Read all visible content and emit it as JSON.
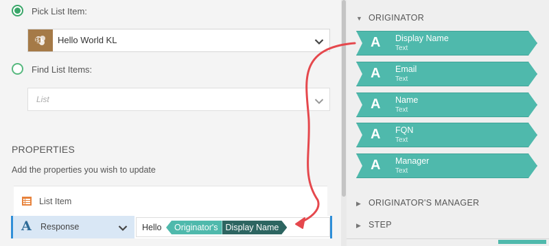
{
  "source": {
    "pick_list_item_label": "Pick List Item:",
    "selected_list": "Hello World KL",
    "find_list_items_label": "Find List Items:",
    "list_placeholder": "List"
  },
  "properties": {
    "title": "PROPERTIES",
    "description": "Add the properties you wish to update",
    "list_item_label": "List Item",
    "response_label": "Response",
    "response_value": {
      "text": "Hello",
      "token_prefix": "Originator's",
      "token_suffix": "Display Name"
    }
  },
  "reference_panel": {
    "groups": [
      {
        "label": "ORIGINATOR",
        "expanded": true
      },
      {
        "label": "ORIGINATOR'S MANAGER",
        "expanded": false
      },
      {
        "label": "STEP",
        "expanded": false
      }
    ],
    "items": [
      {
        "icon": "A",
        "name": "Display Name",
        "type": "Text"
      },
      {
        "icon": "A",
        "name": "Email",
        "type": "Text"
      },
      {
        "icon": "A",
        "name": "Name",
        "type": "Text"
      },
      {
        "icon": "A",
        "name": "FQN",
        "type": "Text"
      },
      {
        "icon": "A",
        "name": "Manager",
        "type": "Text"
      }
    ]
  },
  "colors": {
    "radio_green": "#3aa669",
    "token_teal": "#4fb9ac",
    "token_dark": "#2d6561",
    "selection_blue": "#2e8ed8",
    "arrow_red": "#e5484d",
    "list_icon_brown": "#a57a47"
  },
  "icons": {
    "list_icon": "sharepoint-list-icon",
    "list_item_icon": "list-item-icon",
    "text_type_icon": "text-a-icon"
  }
}
